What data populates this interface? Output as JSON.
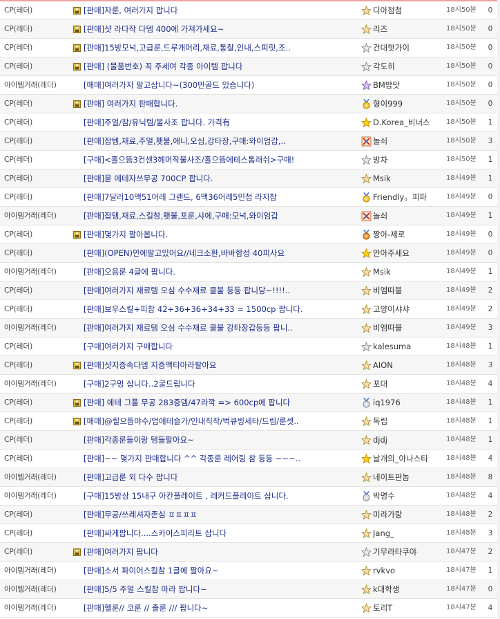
{
  "rows": [
    {
      "category": "CP(레더)",
      "locked": true,
      "title": "[판매]자룬, 여러가지 팝니다",
      "badge": "star",
      "author": "디아첨첨",
      "time": "18시50분",
      "count": "0"
    },
    {
      "category": "CP(레더)",
      "locked": true,
      "title": "[판매]샷 라다작 다뎀 400에 가져가세요~",
      "badge": "star",
      "author": "리즈",
      "time": "18시50분",
      "count": "0"
    },
    {
      "category": "CP(레더)",
      "locked": true,
      "title": "[판매]15방모넉,고급룬,드루개머리,재료,통찰,인내,스피릿,조..",
      "badge": "star-gray",
      "author": "건대핫가이",
      "time": "18시50분",
      "count": "0"
    },
    {
      "category": "CP(레더)",
      "locked": true,
      "title": "[판매] (물품번호) 꼭 주세여 각종 아이템 팝니다",
      "badge": "star-gray",
      "author": "각도히",
      "time": "18시50분",
      "count": "0"
    },
    {
      "category": "아이템거래(레더)",
      "locked": false,
      "title": "[매매]여러가지 팔고삽니다~(300만골드 있습니다)",
      "badge": "star-purple",
      "author": "BM밥맛",
      "time": "18시50분",
      "count": "0"
    },
    {
      "category": "CP(레더)",
      "locked": true,
      "title": "[판매] 여러가지 판매합니다.",
      "badge": "medal-gold",
      "author": "형이999",
      "time": "18시50분",
      "count": "0"
    },
    {
      "category": "CP(레더)",
      "locked": false,
      "title": "[판매]주얼/참/유닉템/불사조 팝니다. 가격有",
      "badge": "star-gold",
      "author": "D.Korea_비너스",
      "time": "18시50분",
      "count": "1"
    },
    {
      "category": "CP(레더)",
      "locked": false,
      "title": "[판매]잡템,재료,주얼,횃불,애니,오심,강타장,구매:와이엄갑,..",
      "badge": "cross-swords",
      "author": "놀쇠",
      "time": "18시50분",
      "count": "3"
    },
    {
      "category": "CP(레더)",
      "locked": false,
      "title": "[구매]<홀으뜸3컨센3헤머작불사조/홀으뜸에테스톰래쉬>구매!",
      "badge": "star-gray",
      "author": "방차",
      "time": "18시50분",
      "count": "1"
    },
    {
      "category": "CP(레더)",
      "locked": false,
      "title": "[판매]묻 에테자쓰무공 700CP 팝니다.",
      "badge": "star",
      "author": "Msik",
      "time": "18시49분",
      "count": "1"
    },
    {
      "category": "CP(레더)",
      "locked": false,
      "title": "[판매]7달러10맥51어레 그랜드, 6맥36어레5민첩 라지참",
      "badge": "medal-gold",
      "author": "Friendly。피파",
      "time": "18시49분",
      "count": "0"
    },
    {
      "category": "아이템거래(레더)",
      "locked": false,
      "title": "[판매]잡템,재료,스킬참,횃불,포룬,샤에,구매:모넉,와이엄갑",
      "badge": "cross-swords",
      "author": "놀쇠",
      "time": "18시49분",
      "count": "1"
    },
    {
      "category": "CP(레더)",
      "locked": true,
      "title": "[판매]몇가지 팔아봅니다.",
      "badge": "medal-orange",
      "author": "짱아-제로",
      "time": "18시49분",
      "count": "0"
    },
    {
      "category": "CP(레더)",
      "locked": false,
      "title": "[판매](OPEN)안에팔고있어요//네크소환,바바함성 40피사요",
      "badge": "star-gold",
      "author": "안아주세요",
      "time": "18시49분",
      "count": "0"
    },
    {
      "category": "아이템거래(레더)",
      "locked": false,
      "title": "[판매]오음룬 4글에 팝니다.",
      "badge": "star",
      "author": "Msik",
      "time": "18시49분",
      "count": "1"
    },
    {
      "category": "CP(레더)",
      "locked": false,
      "title": "[판매]여러가지 재료템 오심 수수재료 쿨불 등등 팝니당~!!!!..",
      "badge": "star",
      "author": "비엠따블",
      "time": "18시49분",
      "count": "2"
    },
    {
      "category": "CP(레더)",
      "locked": false,
      "title": "[판매]보우스킬+피참 42+36+36+34+33 = 1500cp 팝니다.",
      "badge": "star",
      "author": "고양이샤샤",
      "time": "18시49분",
      "count": "2"
    },
    {
      "category": "아이템거래(레더)",
      "locked": false,
      "title": "[판매]여러가지 재료템 오심 수수재료 쿨불 강타장갑등등 팝니..",
      "badge": "star",
      "author": "비엠따블",
      "time": "18시49분",
      "count": "3"
    },
    {
      "category": "CP(레더)",
      "locked": false,
      "title": "[구매]여러가지 구매합니다",
      "badge": "star-gray",
      "author": "kalesuma",
      "time": "18시48분",
      "count": "1"
    },
    {
      "category": "CP(레더)",
      "locked": true,
      "title": "[판매]샷지증속다뎀 지증맥티아라팔아요",
      "badge": "star",
      "author": "AION",
      "time": "18시48분",
      "count": "3"
    },
    {
      "category": "아이템거래(레더)",
      "locked": false,
      "title": "[구매]2구멍 삽니다..2굴드립니다",
      "badge": "star",
      "author": "포대",
      "time": "18시48분",
      "count": "4"
    },
    {
      "category": "CP(레더)",
      "locked": true,
      "title": "[판매] 에테 그폴 무공 283증뎀/47라깍 => 600cp에 팝니다",
      "badge": "medal-silver",
      "author": "iq1976",
      "time": "18시48분",
      "count": "1"
    },
    {
      "category": "CP(레더)",
      "locked": true,
      "title": "[매매]@힐으뜸야수/업에테슬가/인내직작/벅큐빙세타/드림/룬셋..",
      "badge": "star",
      "author": "독립",
      "time": "18시48분",
      "count": "1"
    },
    {
      "category": "CP(레더)",
      "locked": false,
      "title": "[판매]각종룬들이랑 탬들팔아요~",
      "badge": "star",
      "author": "djdj",
      "time": "18시48분",
      "count": "1"
    },
    {
      "category": "CP(레더)",
      "locked": false,
      "title": "[판매]~~ 몇가지 판매합니다 ^^ 각종룬 레어링 참 등등 ~~~..",
      "badge": "star-gold",
      "author": "날개의_아나스타",
      "time": "18시48분",
      "count": "4"
    },
    {
      "category": "아이템거래(레더)",
      "locked": false,
      "title": "[판매]고급룬 외 다수 팝니다",
      "badge": "star",
      "author": "네이트판놈",
      "time": "18시48분",
      "count": "8"
    },
    {
      "category": "아이템거래(레더)",
      "locked": false,
      "title": "[구매]15방상 15내구 아칸플레이트 , 레커드플레이트 삽니다.",
      "badge": "medal-silver",
      "author": "박명수",
      "time": "18시48분",
      "count": "4"
    },
    {
      "category": "CP(레더)",
      "locked": false,
      "title": "[판매]무공/쓰레셔자존심 ㅍㅍㅍㅍ",
      "badge": "star",
      "author": "미라가랑",
      "time": "18시48분",
      "count": "2"
    },
    {
      "category": "CP(레더)",
      "locked": false,
      "title": "[판매]싸게팝니다....스카이스피리트 삽니다",
      "badge": "star",
      "author": "Jang_",
      "time": "18시48분",
      "count": "3"
    },
    {
      "category": "CP(레더)",
      "locked": true,
      "title": "[판매]여러가지 팝니다",
      "badge": "star-gray",
      "author": "기무라타쿠야",
      "time": "18시47분",
      "count": "2"
    },
    {
      "category": "아이템거래(레더)",
      "locked": false,
      "title": "[판매]소서 파이어스킬참 1글에 팔아요~",
      "badge": "star",
      "author": "rvkvo",
      "time": "18시47분",
      "count": "1"
    },
    {
      "category": "아이템거래(레더)",
      "locked": false,
      "title": "[판매]5/5 주얼 스킬참 마라 팝니다~",
      "badge": "star",
      "author": "k대학생",
      "time": "18시47분",
      "count": "0"
    },
    {
      "category": "아이템거래(레더)",
      "locked": false,
      "title": "[판매]헬룬// 코룬 // 졸룬 /// 팝니다~",
      "badge": "star",
      "author": "토리T",
      "time": "18시47분",
      "count": "4"
    }
  ],
  "colors": {
    "title": "#1a2a88",
    "row_alt": "#f6f6f6",
    "divider": "#e3e3e3"
  }
}
